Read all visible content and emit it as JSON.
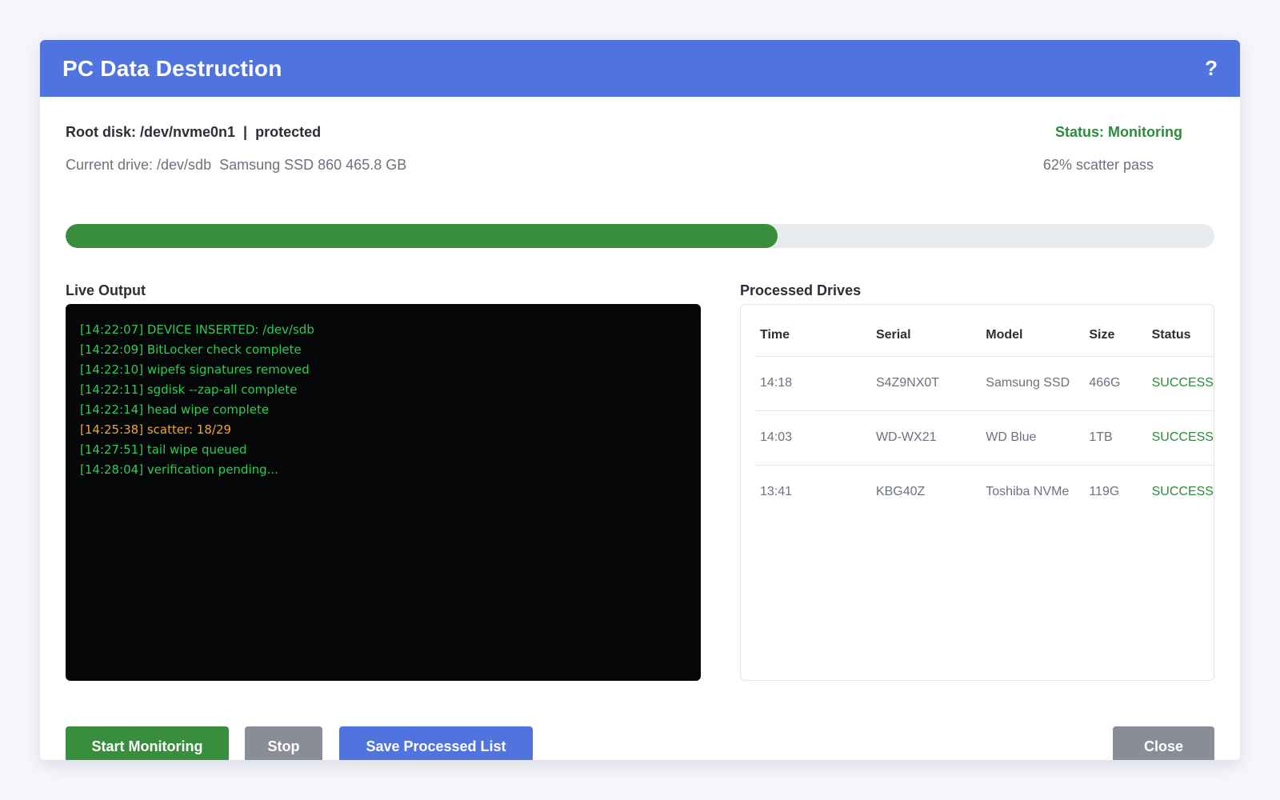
{
  "window": {
    "title": "PC Data Destruction",
    "help_label": "?"
  },
  "header": {
    "root_disk": "Root disk: /dev/nvme0n1  |  protected",
    "status": "Status: Monitoring",
    "current_drive": "Current drive: /dev/sdb  Samsung SSD 860 465.8 GB",
    "pass_text": "62% scatter pass",
    "progress_percent": 62
  },
  "live_output": {
    "label": "Live Output",
    "lines": [
      {
        "text": "[14:22:07] DEVICE INSERTED: /dev/sdb",
        "color": "#2ecc52"
      },
      {
        "text": "[14:22:09] BitLocker check complete",
        "color": "#2ecc52"
      },
      {
        "text": "[14:22:10] wipefs signatures removed",
        "color": "#2ecc52"
      },
      {
        "text": "[14:22:11] sgdisk --zap-all complete",
        "color": "#2ecc52"
      },
      {
        "text": "[14:22:14] head wipe complete",
        "color": "#2ecc52"
      },
      {
        "text": "[14:25:38] scatter: 18/29",
        "color": "#f2a531"
      },
      {
        "text": "[14:27:51] tail wipe queued",
        "color": "#2ecc52"
      },
      {
        "text": "[14:28:04] verification pending...",
        "color": "#2ecc52"
      }
    ]
  },
  "processed": {
    "label": "Processed Drives",
    "columns": [
      "Time",
      "Serial",
      "Model",
      "Size",
      "Status"
    ],
    "rows": [
      [
        "14:18",
        "S4Z9NX0T",
        "Samsung SSD",
        "466G",
        "SUCCESS"
      ],
      [
        "14:03",
        "WD-WX21",
        "WD Blue",
        "1TB",
        "SUCCESS"
      ],
      [
        "13:41",
        "KBG40Z",
        "Toshiba NVMe",
        "119G",
        "SUCCESS"
      ]
    ]
  },
  "buttons": {
    "start": "Start Monitoring",
    "stop": "Stop",
    "save": "Save Processed List",
    "close": "Close"
  }
}
